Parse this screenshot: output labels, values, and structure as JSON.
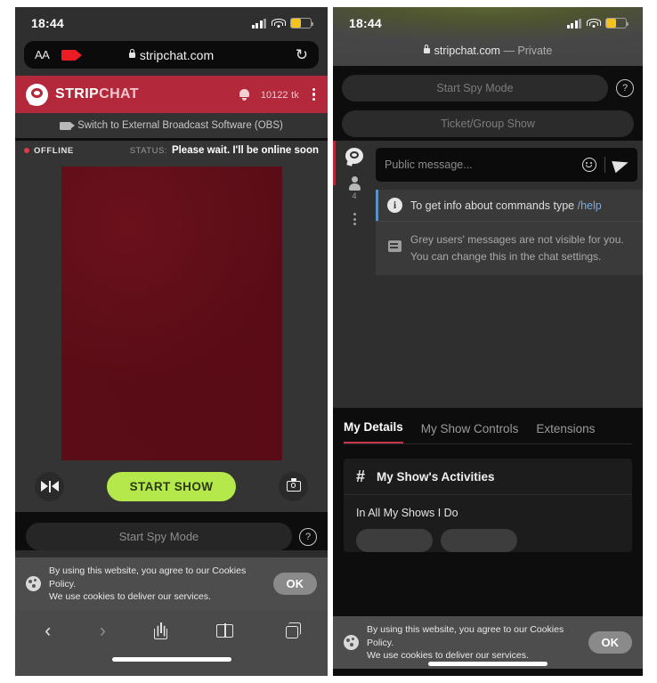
{
  "left_phone": {
    "status_bar": {
      "time": "18:44"
    },
    "safari_url_bar": {
      "text_size_label": "AA",
      "camera_icon": "camera-recording-icon",
      "lock_icon": "lock-icon",
      "url": "stripchat.com",
      "reload_icon": "↻"
    },
    "site_header": {
      "logo_icon": "stripchat-logo-icon",
      "brand_strong": "STRIP",
      "brand_light": "CHAT",
      "bell_icon": "bell-icon",
      "token_amount": "10122",
      "token_unit": "tk",
      "menu_icon": "kebab-menu-icon"
    },
    "obs_bar": {
      "icon": "video-camera-icon",
      "label": "Switch to External Broadcast Software (OBS)"
    },
    "broadcast_status": {
      "offline_label": "OFFLINE",
      "status_key": "STATUS:",
      "status_value": "Please wait. I'll be online soon"
    },
    "controls": {
      "flip_camera_icon": "flip-camera-icon",
      "start_show_label": "START SHOW",
      "snapshot_icon": "camera-icon"
    },
    "spy_row": {
      "spy_label": "Start Spy Mode",
      "help_icon": "question-mark-icon"
    },
    "cookie_banner": {
      "icon": "cookie-icon",
      "line1": "By using this website, you agree to our Cookies Policy.",
      "line2": "We use cookies to deliver our services.",
      "ok_label": "OK"
    },
    "safari_toolbar": {
      "back_icon": "chevron-left-icon",
      "forward_icon": "chevron-right-icon",
      "share_icon": "share-icon",
      "bookmarks_icon": "book-icon",
      "tabs_icon": "tabs-icon"
    }
  },
  "right_phone": {
    "status_bar": {
      "time": "18:44"
    },
    "safari_url": {
      "lock_icon": "lock-icon",
      "url": "stripchat.com",
      "mode": " — Private"
    },
    "show_modes": {
      "spy_label": "Start Spy Mode",
      "help_icon": "question-mark-icon",
      "ticket_label": "Ticket/Group Show"
    },
    "chat_rail": {
      "chat_icon": "chat-bubble-icon",
      "users_icon": "user-icon",
      "users_count": "4",
      "more_icon": "kebab-menu-icon"
    },
    "message_input": {
      "placeholder": "Public message...",
      "emoji_icon": "smiley-icon",
      "send_icon": "send-paper-plane-icon"
    },
    "system_message": {
      "icon": "info-icon",
      "text": "To get info about commands type ",
      "link": "/help"
    },
    "grey_users_message": {
      "icon": "note-icon",
      "text": "Grey users' messages are not visible for you. You can change this in the chat settings."
    },
    "tabs": [
      {
        "label": "My Details",
        "active": true
      },
      {
        "label": "My Show Controls",
        "active": false
      },
      {
        "label": "Extensions",
        "active": false
      }
    ],
    "activities_card": {
      "hash_icon": "hash-icon",
      "title": "My Show's Activities",
      "subtitle": "In All My Shows I Do"
    },
    "cookie_banner": {
      "icon": "cookie-icon",
      "line1": "By using this website, you agree to our Cookies Policy.",
      "line2": "We use cookies to deliver our services.",
      "ok_label": "OK"
    }
  },
  "colors": {
    "brand_red": "#b3283a",
    "start_show_green": "#b5e84a",
    "link_blue": "#7fa8d6",
    "offline_red": "#e03a4a"
  }
}
